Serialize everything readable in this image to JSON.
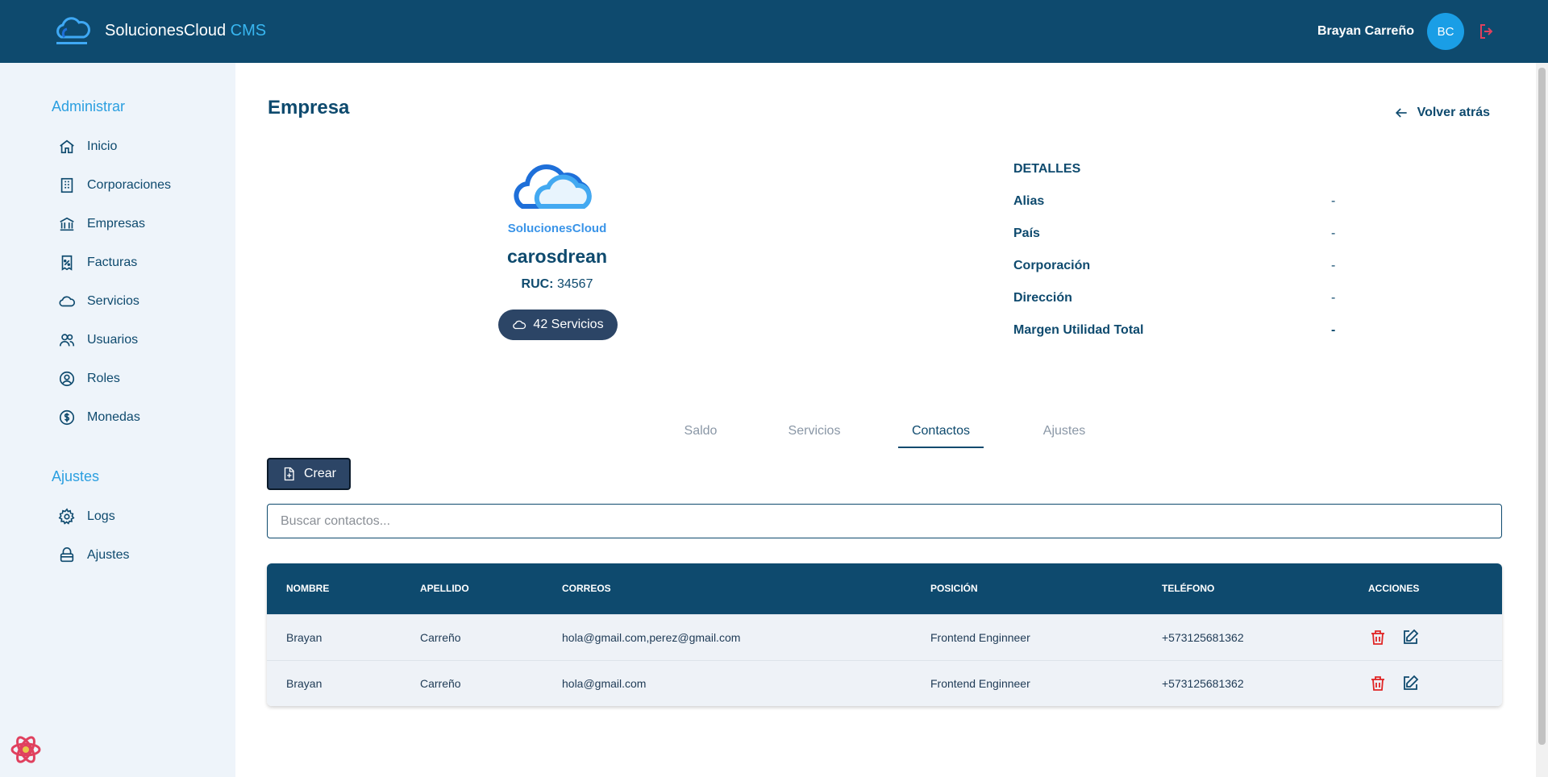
{
  "header": {
    "brand_name": "SolucionesCloud",
    "brand_suffix": "CMS",
    "user_name": "Brayan Carreño",
    "avatar_initials": "BC"
  },
  "sidebar": {
    "admin_title": "Administrar",
    "admin_items": [
      {
        "label": "Inicio",
        "icon": "home-icon"
      },
      {
        "label": "Corporaciones",
        "icon": "building-icon"
      },
      {
        "label": "Empresas",
        "icon": "bank-icon"
      },
      {
        "label": "Facturas",
        "icon": "receipt-icon"
      },
      {
        "label": "Servicios",
        "icon": "cloud-icon"
      },
      {
        "label": "Usuarios",
        "icon": "users-icon"
      },
      {
        "label": "Roles",
        "icon": "user-circle-icon"
      },
      {
        "label": "Monedas",
        "icon": "currency-icon"
      }
    ],
    "settings_title": "Ajustes",
    "settings_items": [
      {
        "label": "Logs",
        "icon": "gear-icon"
      },
      {
        "label": "Ajustes",
        "icon": "database-icon"
      }
    ]
  },
  "page": {
    "title": "Empresa",
    "back_label": "Volver atrás"
  },
  "company": {
    "logo_text": "SolucionesCloud",
    "name": "carosdrean",
    "ruc_label": "RUC:",
    "ruc_value": "34567",
    "services_label": "42 Servicios"
  },
  "details": {
    "heading": "DETALLES",
    "rows": [
      {
        "key": "Alias",
        "value": "-"
      },
      {
        "key": "País",
        "value": "-"
      },
      {
        "key": "Corporación",
        "value": "-"
      },
      {
        "key": "Dirección",
        "value": "-"
      },
      {
        "key": "Margen Utilidad Total",
        "value": "-"
      }
    ]
  },
  "tabs": [
    {
      "label": "Saldo",
      "active": false
    },
    {
      "label": "Servicios",
      "active": false
    },
    {
      "label": "Contactos",
      "active": true
    },
    {
      "label": "Ajustes",
      "active": false
    }
  ],
  "contacts": {
    "create_label": "Crear",
    "search_placeholder": "Buscar contactos...",
    "columns": [
      "NOMBRE",
      "APELLIDO",
      "CORREOS",
      "POSICIÓN",
      "TELÉFONO",
      "ACCIONES"
    ],
    "rows": [
      [
        "Brayan",
        "Carreño",
        "hola@gmail.com,perez@gmail.com",
        "Frontend Enginneer",
        "+573125681362"
      ],
      [
        "Brayan",
        "Carreño",
        "hola@gmail.com",
        "Frontend Enginneer",
        "+573125681362"
      ]
    ]
  },
  "colors": {
    "primary": "#0e4a6e",
    "accent": "#2b9fe0",
    "danger": "#e02424"
  }
}
